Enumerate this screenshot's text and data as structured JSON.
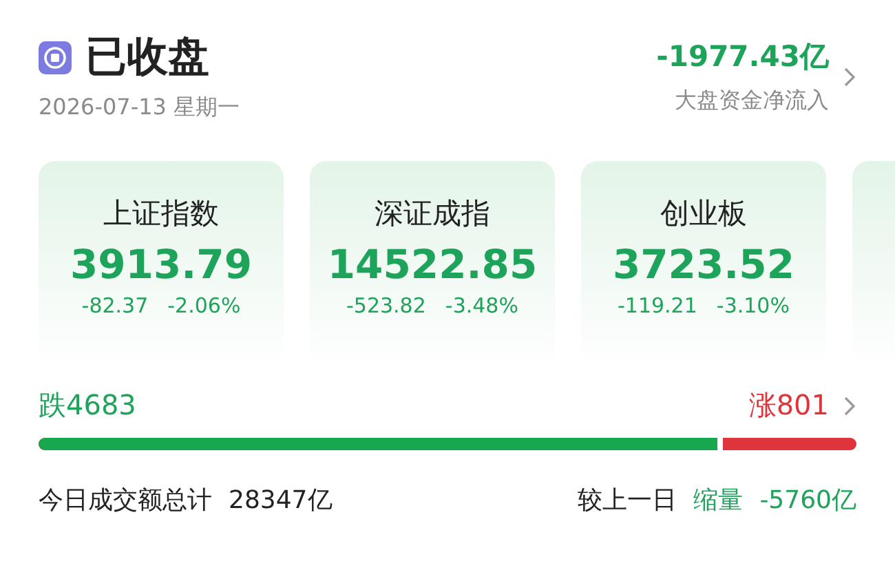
{
  "header": {
    "title": "已收盘",
    "date": "2026-07-13 星期一",
    "net_flow": "-1977.43亿",
    "net_flow_label": "大盘资金净流入"
  },
  "indices": [
    {
      "kind": "full",
      "name": "上证指数",
      "value": "3913.79",
      "change": "-82.37",
      "percent": "-2.06%"
    },
    {
      "kind": "full",
      "name": "深证成指",
      "value": "14522.85",
      "change": "-523.82",
      "percent": "-3.48%"
    },
    {
      "kind": "full",
      "name": "创业板",
      "value": "3723.52",
      "change": "-119.21",
      "percent": "-3.10%"
    },
    {
      "kind": "partial"
    }
  ],
  "breadth": {
    "down": "跌4683",
    "up": "涨801",
    "level": 0.83
  },
  "turnover": {
    "label": "今日成交额总计",
    "amount": "28347亿",
    "compare_label": "较上一日",
    "trend": "缩量",
    "delta": "-5760亿"
  }
}
